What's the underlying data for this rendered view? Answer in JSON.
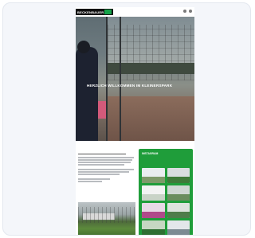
{
  "site": {
    "logo_text": "BECKENBAUER",
    "hero_title": "HERZLICH WILLKOMMEN IM KLEINERSPARK"
  },
  "sidebar": {
    "title": "INSTAGRAM"
  },
  "colors": {
    "brand_green": "#1f9d3a",
    "header_black": "#111111"
  }
}
